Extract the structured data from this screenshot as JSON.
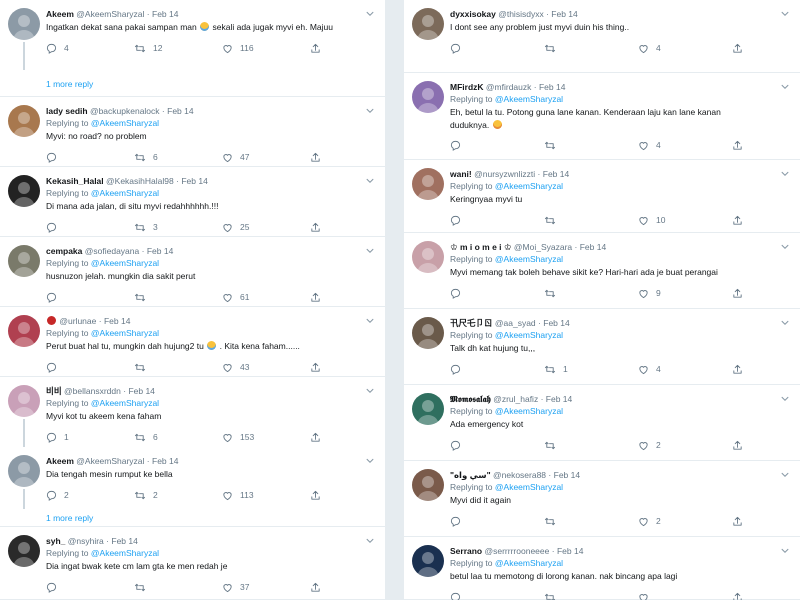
{
  "left_tweets": [
    {
      "display_name": "Akeem",
      "handle": "@AkeemSharyzal",
      "date": "Feb 14",
      "replying_to": "",
      "text": "Ingatkan dekat sana pakai sampan man",
      "text_tail": "sekali ada jugak myvi eh. Majuu",
      "text_line2": "",
      "replies": "4",
      "retweets": "12",
      "likes": "116",
      "avatar_color": "#8c9aa6"
    },
    {
      "display_name": "lady sedih",
      "handle": "@backupkenalock",
      "date": "Feb 14",
      "replying_to": "@AkeemSharyzal",
      "text": "Myvi: no road? no problem",
      "replies": "",
      "retweets": "6",
      "likes": "47",
      "avatar_color": "#a8784e"
    },
    {
      "display_name": "Kekasih_Halal",
      "handle": "@KekasihHalal98",
      "date": "Feb 14",
      "replying_to": "@AkeemSharyzal",
      "text": "Di mana ada jalan, di situ myvi redahhhhhh.!!!",
      "replies": "",
      "retweets": "3",
      "likes": "25",
      "avatar_color": "#222222"
    },
    {
      "display_name": "cempaka",
      "handle": "@sofiedayana",
      "date": "Feb 14",
      "replying_to": "@AkeemSharyzal",
      "text": "husnuzon jelah. mungkin dia sakit perut",
      "replies": "",
      "retweets": "",
      "likes": "61",
      "avatar_color": "#7a7a6a"
    },
    {
      "display_name": "",
      "handle": "@urlunae",
      "date": "Feb 14",
      "replying_to": "@AkeemSharyzal",
      "text": "Perut buat hal tu, mungkin dah hujung2 tu",
      "text_tail": ". Kita kena faham......",
      "replies": "",
      "retweets": "",
      "likes": "43",
      "avatar_color": "#b04050"
    },
    {
      "display_name": "비비",
      "handle": "@bellansxrddn",
      "date": "Feb 14",
      "replying_to": "@AkeemSharyzal",
      "text": "Myvi kot tu akeem kena faham",
      "replies": "1",
      "retweets": "6",
      "likes": "153",
      "avatar_color": "#c9a0b8"
    },
    {
      "display_name": "Akeem",
      "handle": "@AkeemSharyzal",
      "date": "Feb 14",
      "replying_to": "",
      "text": "Dia tengah mesin rumput ke bella",
      "replies": "2",
      "retweets": "2",
      "likes": "113",
      "avatar_color": "#8c9aa6"
    },
    {
      "display_name": "syh_",
      "handle": "@nsyhira",
      "date": "Feb 14",
      "replying_to": "@AkeemSharyzal",
      "text": "Dia ingat bwak kete cm lam gta ke  men redah je",
      "replies": "",
      "retweets": "",
      "likes": "37",
      "avatar_color": "#2a2a2a"
    }
  ],
  "more_replies_label": "1 more reply",
  "right_tweets": [
    {
      "display_name": "dyxxisokay",
      "handle": "@thisisdyxx",
      "date": "Feb 14",
      "replying_to": "",
      "text": "I dont see any problem just myvi duin his thing..",
      "replies": "",
      "retweets": "",
      "likes": "4",
      "avatar_color": "#7c6a5a"
    },
    {
      "display_name": "MFirdzK",
      "handle": "@mfirdauzk",
      "date": "Feb 14",
      "replying_to": "@AkeemSharyzal",
      "text": "Eh, betul la tu. Potong guna lane kanan. Kenderaan laju kan lane kanan",
      "text_line2": "duduknya.",
      "replies": "",
      "retweets": "",
      "likes": "4",
      "avatar_color": "#8a6fb0"
    },
    {
      "display_name": "wani!",
      "handle": "@nursyzwnlizzti",
      "date": "Feb 14",
      "replying_to": "@AkeemSharyzal",
      "text": "Keringnyaa myvi tu",
      "replies": "",
      "retweets": "",
      "likes": "10",
      "avatar_color": "#a07060"
    },
    {
      "display_name": "♔ m i o m e i ♔",
      "handle": "@Moi_Syazara",
      "date": "Feb 14",
      "replying_to": "@AkeemSharyzal",
      "text": "Myvi memang tak boleh behave sikit ke? Hari-hari ada je buat perangai",
      "replies": "",
      "retweets": "",
      "likes": "9",
      "avatar_color": "#c8a0a8"
    },
    {
      "display_name": "卂尺乇卩ㄖ",
      "handle": "@aa_syad",
      "date": "Feb 14",
      "replying_to": "@AkeemSharyzal",
      "text": "Talk dh kat hujung tu,,,",
      "replies": "",
      "retweets": "1",
      "likes": "4",
      "avatar_color": "#6a5a4a"
    },
    {
      "display_name": "𝕸𝖔𝖒𝖔𝖘𝖆𝖑𝖆𝖍",
      "handle": "@zrul_hafiz",
      "date": "Feb 14",
      "replying_to": "@AkeemSharyzal",
      "text": "Ada emergency kot",
      "replies": "",
      "retweets": "",
      "likes": "2",
      "avatar_color": "#2f6f5f"
    },
    {
      "display_name": "\"سي واه\"",
      "handle": "@nekosera88",
      "date": "Feb 14",
      "replying_to": "@AkeemSharyzal",
      "text": "Myvi did it again",
      "replies": "",
      "retweets": "",
      "likes": "2",
      "avatar_color": "#7a5a4a"
    },
    {
      "display_name": "Serrano",
      "handle": "@serrrrrooneeee",
      "date": "Feb 14",
      "replying_to": "@AkeemSharyzal",
      "text": "betul laa tu memotong di lorong kanan. nak bincang apa lagi",
      "replies": "",
      "retweets": "",
      "likes": "",
      "avatar_color": "#1a3050"
    }
  ],
  "labels": {
    "replying_prefix": "Replying to",
    "separator": "·"
  },
  "colors": {
    "link": "#1da1f2",
    "muted": "#657786",
    "divider": "#e6ecf0"
  }
}
